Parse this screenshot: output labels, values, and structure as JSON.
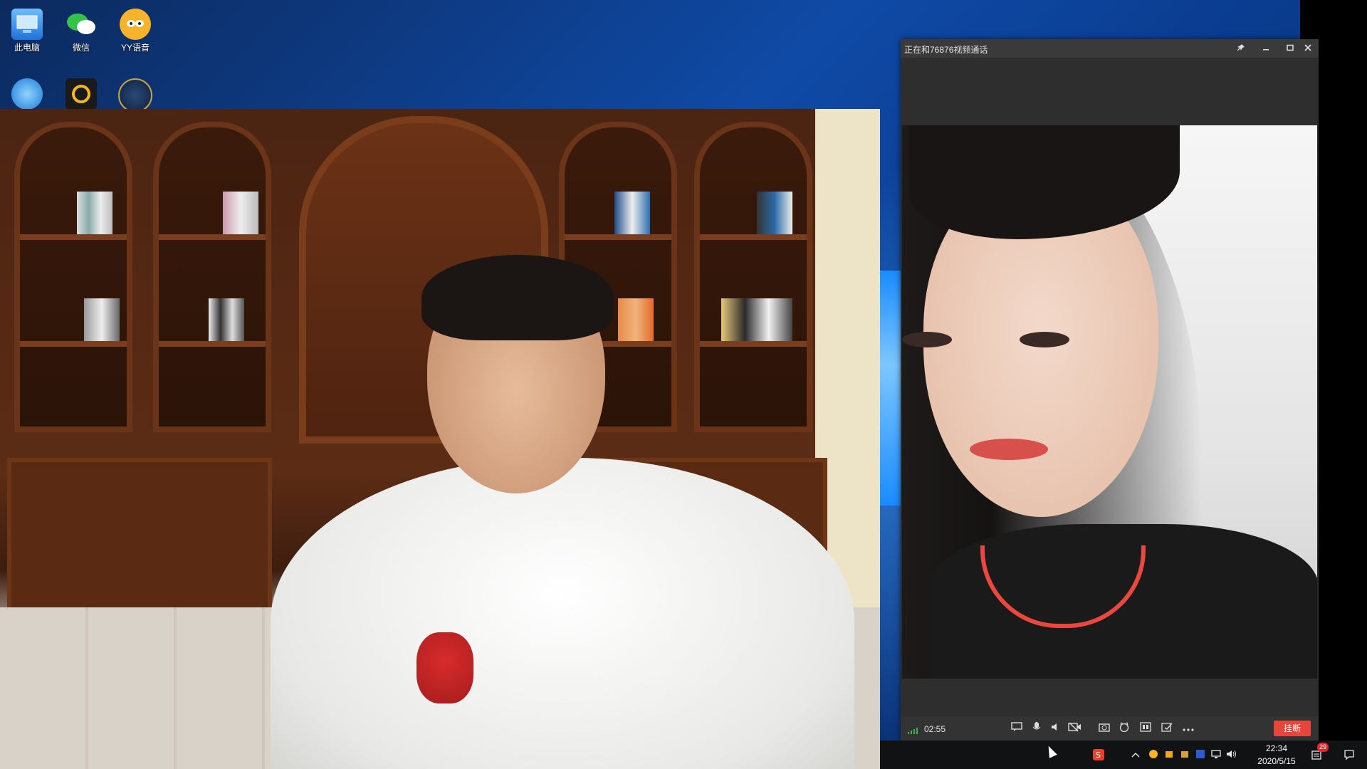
{
  "desktop": {
    "icons": [
      {
        "label": "此电脑",
        "icon": "computer-icon"
      },
      {
        "label": "微信",
        "icon": "wechat-icon"
      },
      {
        "label": "YY语音",
        "icon": "yy-voice-icon"
      },
      {
        "label": "",
        "icon": "network-globe-icon"
      },
      {
        "label": "",
        "icon": "app-shortcut-icon"
      },
      {
        "label": "",
        "icon": "game-shortcut-icon"
      }
    ]
  },
  "call_window": {
    "title": "正在和76876视频通话",
    "title_buttons": [
      "pin",
      "minimize",
      "maximize",
      "close"
    ],
    "duration": "02:55",
    "hangup_label": "挂断",
    "controls": [
      "chat-icon",
      "microphone-icon",
      "speaker-icon",
      "camera-off-icon",
      "snapshot-icon",
      "effects-icon",
      "layout-icon",
      "whiteboard-icon",
      "more-icon"
    ]
  },
  "taskbar": {
    "time": "22:34",
    "date": "2020/5/15",
    "notification_count": "29",
    "tray_icons": [
      "sogou-input-icon",
      "chevron-up-icon",
      "yy-tray-icon",
      "app-tray-icon",
      "game-tray-icon",
      "keyboard-tray-icon",
      "network-icon",
      "volume-icon",
      "notifications-icon"
    ]
  },
  "colors": {
    "hangup": "#e8463a",
    "signal": "#3fb34f",
    "title_bar": "#3a3a3a"
  }
}
